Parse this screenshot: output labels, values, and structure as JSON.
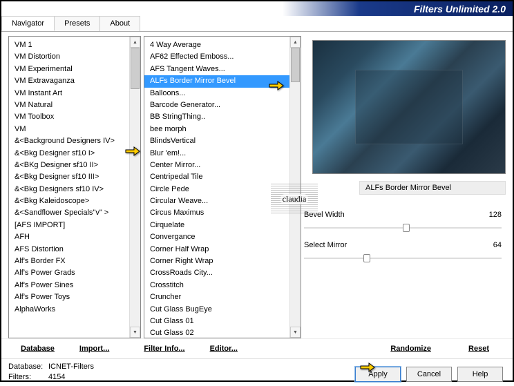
{
  "header": {
    "title": "Filters Unlimited 2.0"
  },
  "tabs": [
    "Navigator",
    "Presets",
    "About"
  ],
  "activeTab": 0,
  "list1": {
    "items": [
      "VM 1",
      "VM Distortion",
      "VM Experimental",
      "VM Extravaganza",
      "VM Instant Art",
      "VM Natural",
      "VM Toolbox",
      "VM",
      "&<Background Designers IV>",
      "&<Bkg Designer sf10 I>",
      "&<BKg Designer sf10 II>",
      "&<Bkg Designer sf10 III>",
      "&<Bkg Designers sf10 IV>",
      "&<Bkg Kaleidoscope>",
      "&<Sandflower Specials\"v\" >",
      "[AFS IMPORT]",
      "AFH",
      "AFS Distortion",
      "Alf's Border FX",
      "Alf's Power Grads",
      "Alf's Power Sines",
      "Alf's Power Toys",
      "AlphaWorks"
    ],
    "selectedIndex": 9
  },
  "list2": {
    "items": [
      "4 Way Average",
      "AF62 Effected Emboss...",
      "AFS Tangent Waves...",
      "ALFs Border Mirror Bevel",
      "Balloons...",
      "Barcode Generator...",
      "BB StringThing..",
      "bee morph",
      "BlindsVertical",
      "Blur 'em!...",
      "Center Mirror...",
      "Centripedal Tile",
      "Circle Pede",
      "Circular Weave...",
      "Circus Maximus",
      "Cirquelate",
      "Convergance",
      "Corner Half Wrap",
      "Corner Right Wrap",
      "CrossRoads City...",
      "Crosstitch",
      "Cruncher",
      "Cut Glass  BugEye",
      "Cut Glass 01",
      "Cut Glass 02"
    ],
    "selectedIndex": 3
  },
  "filterTitle": "ALFs Border Mirror Bevel",
  "params": [
    {
      "label": "Bevel Width",
      "value": 128,
      "pct": 50
    },
    {
      "label": "Select Mirror",
      "value": 64,
      "pct": 30
    }
  ],
  "bottomLinks": {
    "database": "Database",
    "import": "Import...",
    "filterInfo": "Filter Info...",
    "editor": "Editor...",
    "randomize": "Randomize",
    "reset": "Reset"
  },
  "status": {
    "dbLabel": "Database:",
    "dbValue": "ICNET-Filters",
    "filtersLabel": "Filters:",
    "filtersValue": "4154"
  },
  "buttons": {
    "apply": "Apply",
    "cancel": "Cancel",
    "help": "Help"
  },
  "watermark": "claudia"
}
